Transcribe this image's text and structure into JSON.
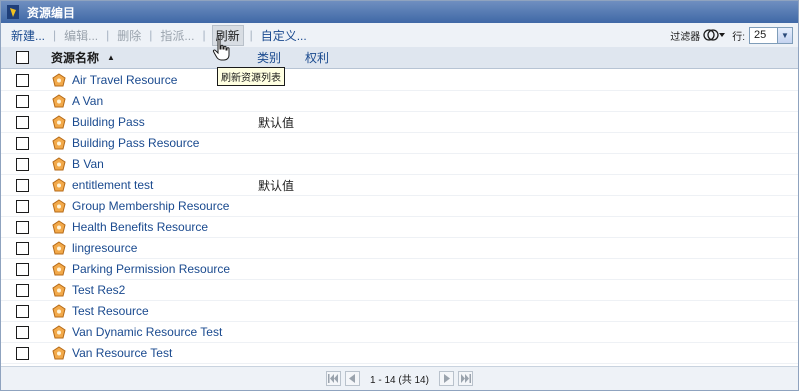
{
  "window": {
    "title": "资源编目"
  },
  "toolbar": {
    "new_label": "新建...",
    "edit_label": "编辑...",
    "delete_label": "删除",
    "assign_label": "指派...",
    "refresh_label": "刷新",
    "customize_label": "自定义...",
    "filter_label": "过滤器",
    "rows_label": "行:",
    "rows_value": "25"
  },
  "tooltip": {
    "text": "刷新资源列表"
  },
  "table": {
    "columns": {
      "name": "资源名称",
      "category": "类别",
      "entitlement": "权利"
    },
    "rows": [
      {
        "name": "Air Travel Resource",
        "category": ""
      },
      {
        "name": "A Van",
        "category": ""
      },
      {
        "name": "Building Pass",
        "category": "默认值"
      },
      {
        "name": "Building Pass Resource",
        "category": ""
      },
      {
        "name": "B Van",
        "category": ""
      },
      {
        "name": "entitlement test",
        "category": "默认值"
      },
      {
        "name": "Group Membership Resource",
        "category": ""
      },
      {
        "name": "Health Benefits Resource",
        "category": ""
      },
      {
        "name": "lingresource",
        "category": ""
      },
      {
        "name": "Parking Permission Resource",
        "category": ""
      },
      {
        "name": "Test Res2",
        "category": ""
      },
      {
        "name": "Test Resource",
        "category": ""
      },
      {
        "name": "Van Dynamic Resource Test",
        "category": ""
      },
      {
        "name": "Van Resource Test",
        "category": ""
      }
    ]
  },
  "pagination": {
    "text": "1 - 14 (共 14)"
  },
  "icons": {
    "app": "app-logo-icon",
    "filter": "filter-icon",
    "resource": "resource-icon",
    "first": "first-page-icon",
    "prev": "prev-page-icon",
    "next": "next-page-icon",
    "last": "last-page-icon"
  },
  "colors": {
    "title_bar": "#3f68a6",
    "link": "#1a4a8f",
    "header_bg": "#dfe6ef"
  }
}
